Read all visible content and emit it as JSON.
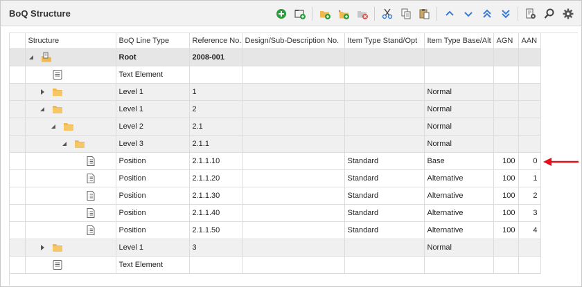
{
  "panel": {
    "title": "BoQ Structure"
  },
  "toolbar": {
    "buttons": [
      {
        "icon": "add-circle-icon"
      },
      {
        "icon": "new-folder-icon"
      },
      {
        "icon": "new-subfolder-icon"
      },
      {
        "icon": "insert-folder-icon"
      },
      {
        "icon": "delete-folder-icon"
      },
      {
        "icon": "cut-icon"
      },
      {
        "icon": "copy-icon"
      },
      {
        "icon": "paste-icon"
      },
      {
        "icon": "move-up-icon"
      },
      {
        "icon": "move-down-icon"
      },
      {
        "icon": "move-top-icon"
      },
      {
        "icon": "move-bottom-icon"
      },
      {
        "icon": "settings-doc-icon"
      },
      {
        "icon": "search-icon"
      },
      {
        "icon": "gear-icon"
      }
    ]
  },
  "grid": {
    "columns": [
      "Structure",
      "BoQ Line Type",
      "Reference No.",
      "Design/Sub-Description No.",
      "Item Type Stand/Opt",
      "Item Type Base/Alt",
      "AGN",
      "AAN"
    ],
    "rows": [
      {
        "depth": 0,
        "expander": "open",
        "icon": "root-icon",
        "line_type": "Root",
        "ref": "2008-001",
        "design": "",
        "stand_opt": "",
        "base_alt": "",
        "agn": "",
        "aan": "",
        "style": "root"
      },
      {
        "depth": 1,
        "expander": "none",
        "icon": "text-element-icon",
        "line_type": "Text Element",
        "ref": "",
        "design": "",
        "stand_opt": "",
        "base_alt": "",
        "agn": "",
        "aan": "",
        "style": ""
      },
      {
        "depth": 1,
        "expander": "closed",
        "icon": "folder-icon",
        "line_type": "Level 1",
        "ref": "1",
        "design": "",
        "stand_opt": "",
        "base_alt": "Normal",
        "agn": "",
        "aan": "",
        "style": "alt"
      },
      {
        "depth": 1,
        "expander": "open",
        "icon": "folder-icon",
        "line_type": "Level 1",
        "ref": "2",
        "design": "",
        "stand_opt": "",
        "base_alt": "Normal",
        "agn": "",
        "aan": "",
        "style": "alt"
      },
      {
        "depth": 2,
        "expander": "open",
        "icon": "folder-icon",
        "line_type": "Level 2",
        "ref": "2.1",
        "design": "",
        "stand_opt": "",
        "base_alt": "Normal",
        "agn": "",
        "aan": "",
        "style": "alt"
      },
      {
        "depth": 3,
        "expander": "open",
        "icon": "folder-icon",
        "line_type": "Level 3",
        "ref": "2.1.1",
        "design": "",
        "stand_opt": "",
        "base_alt": "Normal",
        "agn": "",
        "aan": "",
        "style": "alt"
      },
      {
        "depth": 4,
        "expander": "none",
        "icon": "position-icon",
        "line_type": "Position",
        "ref": "2.1.1.10",
        "design": "",
        "stand_opt": "Standard",
        "base_alt": "Base",
        "agn": "100",
        "aan": "0",
        "style": ""
      },
      {
        "depth": 4,
        "expander": "none",
        "icon": "position-icon",
        "line_type": "Position",
        "ref": "2.1.1.20",
        "design": "",
        "stand_opt": "Standard",
        "base_alt": "Alternative",
        "agn": "100",
        "aan": "1",
        "style": ""
      },
      {
        "depth": 4,
        "expander": "none",
        "icon": "position-icon",
        "line_type": "Position",
        "ref": "2.1.1.30",
        "design": "",
        "stand_opt": "Standard",
        "base_alt": "Alternative",
        "agn": "100",
        "aan": "2",
        "style": ""
      },
      {
        "depth": 4,
        "expander": "none",
        "icon": "position-icon",
        "line_type": "Position",
        "ref": "2.1.1.40",
        "design": "",
        "stand_opt": "Standard",
        "base_alt": "Alternative",
        "agn": "100",
        "aan": "3",
        "style": ""
      },
      {
        "depth": 4,
        "expander": "none",
        "icon": "position-icon",
        "line_type": "Position",
        "ref": "2.1.1.50",
        "design": "",
        "stand_opt": "Standard",
        "base_alt": "Alternative",
        "agn": "100",
        "aan": "4",
        "style": ""
      },
      {
        "depth": 1,
        "expander": "closed",
        "icon": "folder-icon",
        "line_type": "Level 1",
        "ref": "3",
        "design": "",
        "stand_opt": "",
        "base_alt": "Normal",
        "agn": "",
        "aan": "",
        "style": "alt"
      },
      {
        "depth": 1,
        "expander": "none",
        "icon": "text-element-icon",
        "line_type": "Text Element",
        "ref": "",
        "design": "",
        "stand_opt": "",
        "base_alt": "",
        "agn": "",
        "aan": "",
        "style": ""
      }
    ]
  },
  "annotation": {
    "arrow_color": "#e3101a",
    "points_to": "left"
  },
  "colors": {
    "accent_green": "#2e9b3e",
    "icon_blue": "#3a7bd5",
    "folder": "#f0b850",
    "delete_red": "#d9534f"
  }
}
